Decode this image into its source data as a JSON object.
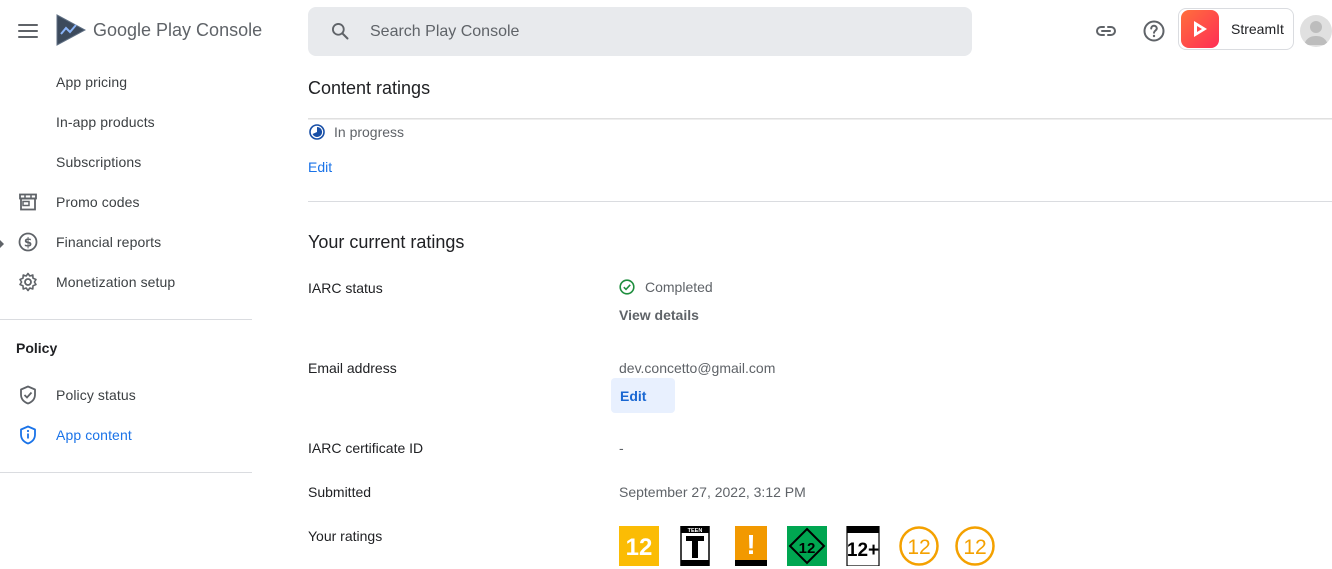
{
  "header": {
    "brand": "Google Play Console",
    "search_placeholder": "Search Play Console",
    "app_name": "StreamIt"
  },
  "sidebar": {
    "items": [
      {
        "label": "App pricing"
      },
      {
        "label": "In-app products"
      },
      {
        "label": "Subscriptions"
      },
      {
        "label": "Promo codes",
        "icon": "storefront-icon"
      },
      {
        "label": "Financial reports",
        "icon": "dollar-circle-icon"
      },
      {
        "label": "Monetization setup",
        "icon": "gear-icon"
      }
    ],
    "policy_title": "Policy",
    "policy_items": [
      {
        "label": "Policy status",
        "icon": "shield-check-icon"
      },
      {
        "label": "App content",
        "icon": "shield-info-icon",
        "active": true
      }
    ]
  },
  "main": {
    "title": "Content ratings",
    "status": "In progress",
    "edit_link": "Edit",
    "current_title": "Your current ratings",
    "rows": {
      "iarc_status_label": "IARC status",
      "iarc_status_value": "Completed",
      "view_details": "View details",
      "email_label": "Email address",
      "email_value": "dev.concetto@gmail.com",
      "email_edit": "Edit",
      "cert_label": "IARC certificate ID",
      "cert_value": "-",
      "submitted_label": "Submitted",
      "submitted_value": "September 27, 2022, 3:12 PM",
      "ratings_label": "Your ratings"
    },
    "ratings": [
      {
        "label": "12",
        "kind": "pegi-like",
        "color": "#fbbc04"
      },
      {
        "label": "TEEN",
        "kind": "esrb"
      },
      {
        "label": "!",
        "kind": "orange-warning",
        "color": "#f29900"
      },
      {
        "label": "12",
        "kind": "usk",
        "color": "#00a651"
      },
      {
        "label": "12+",
        "kind": "iarc"
      },
      {
        "label": "12",
        "kind": "circle",
        "color": "#f4a100"
      },
      {
        "label": "12",
        "kind": "circle",
        "color": "#f4a100"
      }
    ]
  },
  "colors": {
    "accent": "#1a73e8",
    "success": "#1e8e3e"
  }
}
